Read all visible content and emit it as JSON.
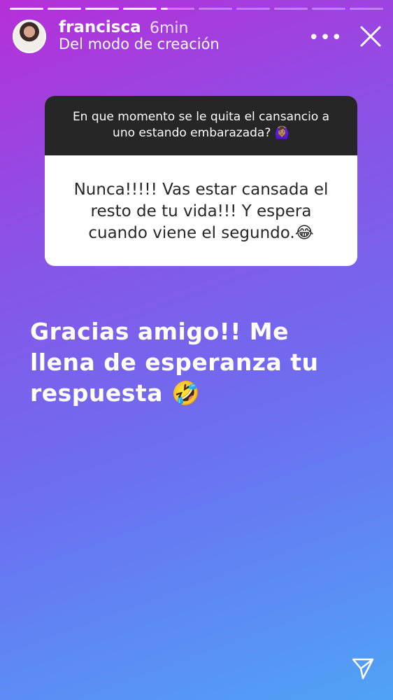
{
  "story": {
    "progress_segments": 10,
    "progress_done": 5,
    "user": {
      "username": "francisca",
      "time": "6min",
      "subtitle": "Del modo de creación"
    },
    "menu_label": "•••",
    "question": "En que momento se le quita el cansancio a uno estando embarazada? 🙆🏽‍♀️",
    "answer": "Nunca!!!!! Vas estar cansada el resto de tu vida!!! Y espera cuando viene el segundo.😂",
    "reply": "Gracias amigo!! Me llena de esperanza tu respuesta 🤣"
  },
  "icons": {
    "menu": "more-dots-icon",
    "close": "close-icon",
    "send": "send-icon"
  }
}
